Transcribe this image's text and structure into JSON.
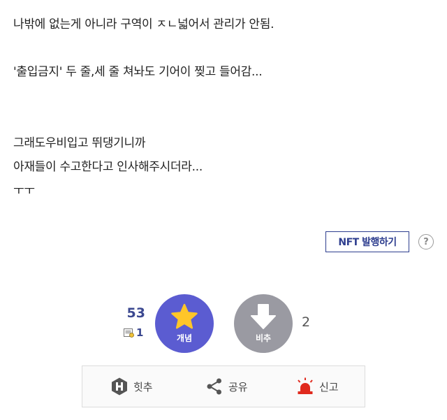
{
  "post": {
    "lines": [
      "나밖에 없는게 아니라 구역이 ㅈㄴ넓어서 관리가 안됨.",
      "",
      "'출입금지' 두 줄,세 줄 쳐놔도 기어이 찢고 들어감...",
      "",
      "",
      "그래도우비입고 뛰댕기니까",
      "아재들이 수고한다고 인사해주시더라...",
      "ㅜㅜ"
    ]
  },
  "nft": {
    "button_label": "NFT 발행하기",
    "help_label": "?"
  },
  "vote": {
    "up_count": "53",
    "fixed_count": "1",
    "up_label": "개념",
    "down_label": "비추",
    "down_count": "2",
    "colors": {
      "up": "#5b5cd1",
      "down": "#9a9aa2",
      "star": "#ffc629"
    }
  },
  "actions": {
    "hit_label": "힛추",
    "share_label": "공유",
    "report_label": "신고",
    "icons": {
      "hit": "hit-h-icon",
      "share": "share-icon",
      "report": "siren-icon"
    },
    "colors": {
      "report": "#e02a1e"
    }
  }
}
